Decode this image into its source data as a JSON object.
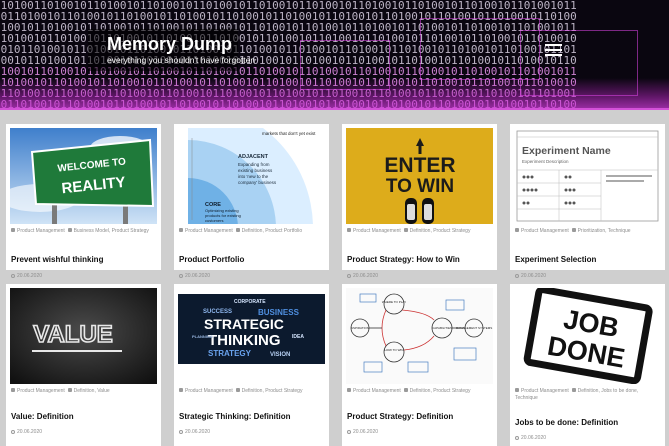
{
  "site": {
    "title": "Memory Dump",
    "tagline": "everything you shouldn't have forgotten"
  },
  "header": {
    "binary_rows": [
      "0101001101001011010010110100101101001011010010110100101101001011010010110100101101001011",
      "1011010010110100101101001011010010110100101101001011010010110100101101001011010010110100",
      "0100101101001011010010110100101101001011010010110100101101001011010010110100101101001011",
      "1101001011010010110100101101001011010010110100101101001011010010110100101101001011010010",
      "0010110100101101001011010010110100101101001011010010110100101101001011010010110100101101",
      "1001011010010110100101101001011010010110100101101001011010010110100101101001011010010110",
      "0100101101001011010010110100101101001011010010110100101101001011010010110100101101001011",
      "1101001011010010110100101101001011010010110100101101001011010010110100101101001011010010",
      "0110100101101001011010010110100101101001011010010110100101101001011010010110100101101001",
      "1011010010110100101101001011010010110100101101001011010010110100101101001011010010110100"
    ],
    "accent": "#d352d8"
  },
  "posts": [
    {
      "image": "welcome-to-reality-sign",
      "img_text": [
        "WELCOME TO",
        "REALITY"
      ],
      "category": "Product Management",
      "tags": "Business Model, Product Strategy",
      "title": "Prevent wishful thinking",
      "date": "20.06.2020"
    },
    {
      "image": "product-portfolio-diagram",
      "img_text": [
        "markets that don't yet exist",
        "ADJACENT",
        "Expanding from",
        "existing business",
        "into 'new to the",
        "company' business",
        "CORE",
        "Optimizing existing",
        "products for existing",
        "customers"
      ],
      "category": "Product Management",
      "tags": "Definition, Product Portfolio",
      "title": "Product Portfolio",
      "date": "20.06.2020"
    },
    {
      "image": "enter-to-win-mat",
      "img_text": [
        "ENTER",
        "TO WIN"
      ],
      "category": "Product Management",
      "tags": "Definition, Product Strategy",
      "title": "Product Strategy: How to Win",
      "date": "20.06.2020"
    },
    {
      "image": "experiment-card",
      "img_text": [
        "Experiment Name",
        "Experiment Description"
      ],
      "category": "Product Management",
      "tags": "Prioritization, Technique",
      "title": "Experiment Selection",
      "date": "20.06.2020"
    },
    {
      "image": "value-chalk-text",
      "img_text": [
        "VALUE"
      ],
      "category": "Product Management",
      "tags": "Definition, Value",
      "title": "Value: Definition",
      "date": "20.06.2020"
    },
    {
      "image": "strategic-thinking-word-cloud",
      "img_text": [
        "STRATEGIC",
        "THINKING",
        "STRATEGY",
        "BUSINESS",
        "SUCCESS",
        "CORPORATE",
        "PLANNING",
        "VISION",
        "IDEA"
      ],
      "category": "Product Management",
      "tags": "Definition, Product Strategy",
      "title": "Strategic Thinking: Definition",
      "date": "20.06.2020"
    },
    {
      "image": "strategy-cycle-sketch",
      "img_text": [
        "WHERE TO PLAY",
        "HOW TO WIN",
        "ASPIRATION",
        "CAPABILITIES",
        "MANAGEMENT SYSTEMS"
      ],
      "category": "Product Management",
      "tags": "Definition, Product Strategy",
      "title": "Product Strategy: Definition",
      "date": "20.06.2020"
    },
    {
      "image": "job-done-stamp",
      "img_text": [
        "JOB",
        "DONE"
      ],
      "category": "Product Management",
      "tags": "Definition, Jobs to be done, Technique",
      "title": "Jobs to be done: Definition",
      "date": "20.06.2020"
    }
  ]
}
